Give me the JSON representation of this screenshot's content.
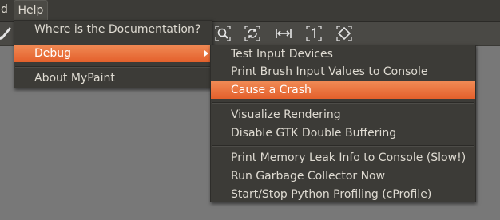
{
  "menubar": {
    "partial_label": "d",
    "help_label": "Help"
  },
  "toolbar": {
    "icons": [
      "brush-icon",
      "zoom-icon",
      "reset-view-icon",
      "fit-width-icon",
      "zoom-1-icon",
      "rotate-view-icon"
    ]
  },
  "help_menu": {
    "items": [
      {
        "label": "Where is the Documentation?"
      },
      {
        "label": "Debug",
        "has_submenu": true,
        "highlighted": true
      },
      {
        "label": "About MyPaint"
      }
    ]
  },
  "debug_menu": {
    "items": [
      {
        "label": "Test Input Devices"
      },
      {
        "label": "Print Brush Input Values to Console"
      },
      {
        "label": "Cause a Crash",
        "highlighted": true
      },
      {
        "label": "Visualize Rendering"
      },
      {
        "label": "Disable GTK Double Buffering"
      },
      {
        "label": "Print Memory Leak Info to Console (Slow!)"
      },
      {
        "label": "Run Garbage Collector Now"
      },
      {
        "label": "Start/Stop Python Profiling (cProfile)"
      }
    ]
  },
  "colors": {
    "menu_bg": "#3c3b37",
    "menu_text": "#dfdbd2",
    "highlight": "#e9673a",
    "canvas": "#787878"
  }
}
